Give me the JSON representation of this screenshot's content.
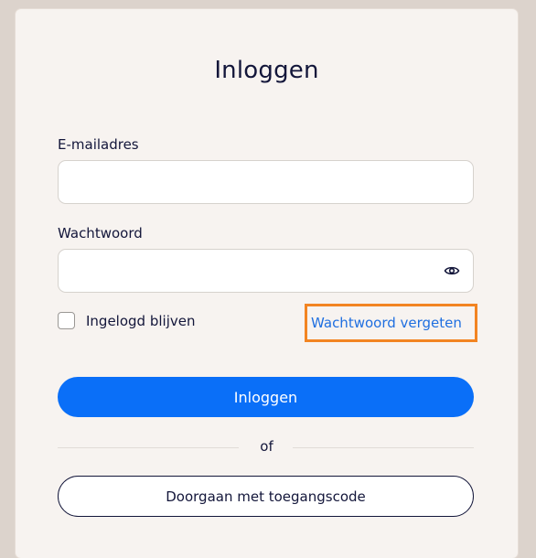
{
  "login": {
    "title": "Inloggen",
    "email_label": "E-mailadres",
    "email_value": "",
    "password_label": "Wachtwoord",
    "password_value": "",
    "show_password_icon": "eye-icon",
    "remember_me_label": "Ingelogd blijven",
    "remember_me_checked": false,
    "forgot_password_link": "Wachtwoord vergeten",
    "submit_button": "Inloggen",
    "divider_text": "of",
    "access_code_button": "Doorgaan met toegangscode"
  },
  "colors": {
    "background": "#dcd3cc",
    "card": "#f7f3f0",
    "primary": "#0a6ff8",
    "link": "#1f6fe0",
    "highlight": "#f28422",
    "text": "#13163a"
  }
}
